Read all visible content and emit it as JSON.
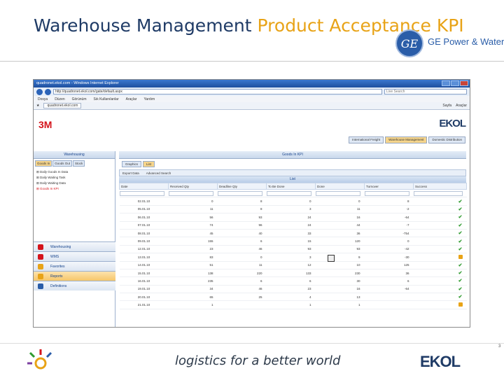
{
  "slide": {
    "title_part1": "Warehouse Management ",
    "title_part2": "Product Acceptance KPI",
    "brand_text": "GE Power & Water",
    "ge_logo_text": "GE",
    "tagline": "logistics for a better world",
    "ekol_logo": "EKOL",
    "page_number": "3",
    "colors": {
      "title_blue": "#1f3b66",
      "title_orange": "#e8a317"
    }
  },
  "browser": {
    "window_title": "quadronet.ekol.com - Windows Internet Explorer",
    "address": "http://quadronet.ekol.com/gate/default.aspx",
    "search_placeholder": "Live Search",
    "menu": [
      "Dosya",
      "Düzen",
      "Görünüm",
      "Sık Kullanılanlar",
      "Araçlar",
      "Yardım"
    ],
    "favorite_tab": "quadronet.ekol.com",
    "tools": [
      "Sayfa",
      "Araçlar"
    ]
  },
  "app": {
    "logo_3m": "3M",
    "top_tabs": [
      "International Freight",
      "Warehouse Management",
      "Domestic Distribution"
    ],
    "active_top_tab": "Warehouse Management",
    "left_panel_title": "Warehousing",
    "left_tabs": [
      "Goods In",
      "Goods Out",
      "Stock"
    ],
    "tree": [
      "Daily Goods In Data",
      "Daily Waiting Task",
      "Daily Waiting Data",
      "Goods In KPI"
    ],
    "accordion": [
      "Warehousing",
      "WMS",
      "Favorites",
      "Reports",
      "Definitions"
    ],
    "main_title": "Goods In KPI",
    "main_tabs": [
      "Graphics",
      "List"
    ],
    "toolbar": [
      "Export Data",
      "Advanced Search"
    ],
    "list_header": "List",
    "columns": [
      "Date",
      "Received Qty",
      "Deadline Qty",
      "To Be Done",
      "Done",
      "Turnover",
      "Success"
    ],
    "rows": [
      [
        "02.01.10",
        "0",
        "8",
        "0",
        "0",
        "8",
        "ok"
      ],
      [
        "05.01.10",
        "11",
        "8",
        "3",
        "11",
        "-2",
        "ok"
      ],
      [
        "06.01.10",
        "56",
        "93",
        "24",
        "16",
        "-64",
        "ok"
      ],
      [
        "07.01.10",
        "74",
        "96",
        "24",
        "44",
        "-7",
        "ok"
      ],
      [
        "08.01.10",
        "45",
        "40",
        "33",
        "36",
        "-754",
        "ok"
      ],
      [
        "09.01.10",
        "155",
        "6",
        "15",
        "120",
        "0",
        "ok"
      ],
      [
        "12.01.10",
        "23",
        "46",
        "93",
        "93",
        "-42",
        "ok"
      ],
      [
        "13.01.10",
        "83",
        "0",
        "3",
        "9",
        "-30",
        "warn"
      ],
      [
        "14.01.10",
        "51",
        "11",
        "12",
        "10",
        "125",
        "ok"
      ],
      [
        "15.01.10",
        "138",
        "220",
        "133",
        "230",
        "36",
        "ok"
      ],
      [
        "16.01.10",
        "235",
        "6",
        "6",
        "30",
        "6",
        "ok"
      ],
      [
        "19.01.10",
        "34",
        "46",
        "23",
        "16",
        "-64",
        "ok"
      ],
      [
        "20.01.10",
        "65",
        "25",
        "4",
        "13",
        "",
        "ok"
      ],
      [
        "21.01.10",
        "1",
        "",
        "1",
        "1",
        "",
        "warn"
      ]
    ]
  }
}
